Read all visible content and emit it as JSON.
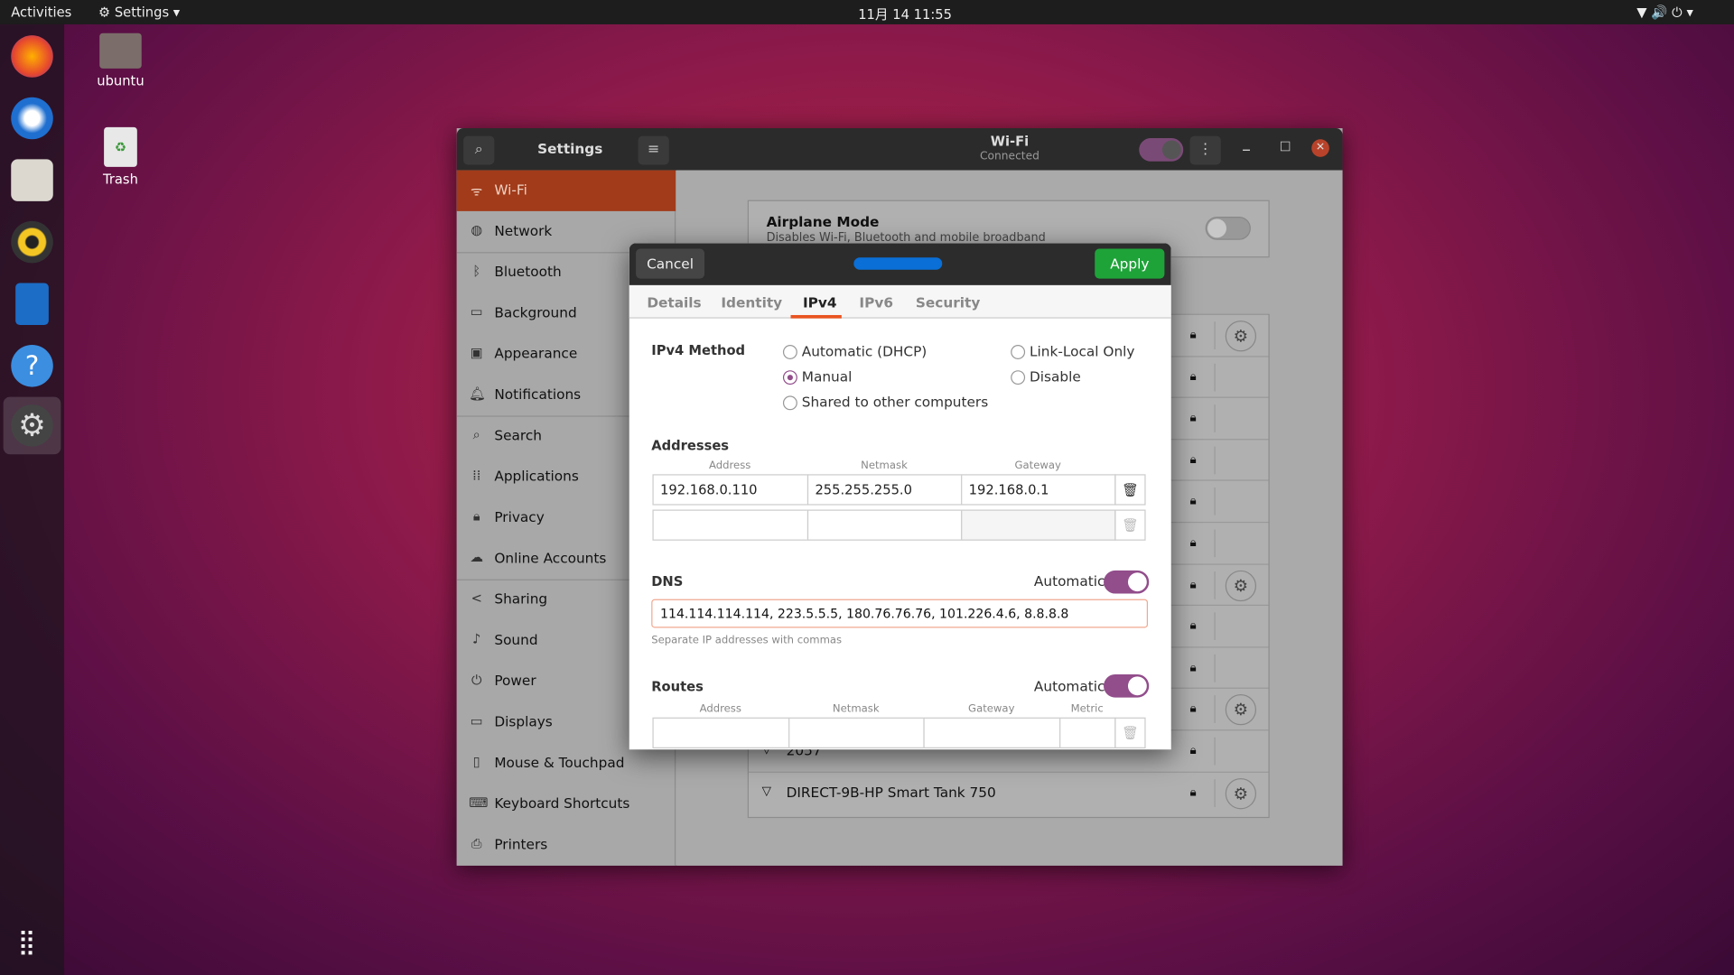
{
  "topbar": {
    "activities": "Activities",
    "app_menu": "Settings",
    "clock": "11月 14  11:55"
  },
  "desktop": {
    "icons": [
      {
        "label": "ubuntu"
      },
      {
        "label": "Trash"
      }
    ]
  },
  "dock": {
    "apps": [
      "Firefox",
      "Thunderbird",
      "Files",
      "Rhythmbox",
      "LibreOffice Writer",
      "Help",
      "Settings"
    ]
  },
  "settings": {
    "title": "Settings",
    "panel_title": "Wi-Fi",
    "panel_subtitle": "Connected",
    "sidebar": [
      {
        "label": "Wi-Fi",
        "icon": "wifi-icon"
      },
      {
        "label": "Network",
        "icon": "network-icon"
      },
      {
        "label": "Bluetooth",
        "icon": "bluetooth-icon"
      },
      {
        "label": "Background",
        "icon": "background-icon"
      },
      {
        "label": "Appearance",
        "icon": "appearance-icon"
      },
      {
        "label": "Notifications",
        "icon": "bell-icon"
      },
      {
        "label": "Search",
        "icon": "search-icon"
      },
      {
        "label": "Applications",
        "icon": "applications-icon"
      },
      {
        "label": "Privacy",
        "icon": "lock-icon"
      },
      {
        "label": "Online Accounts",
        "icon": "cloud-icon"
      },
      {
        "label": "Sharing",
        "icon": "share-icon"
      },
      {
        "label": "Sound",
        "icon": "music-icon"
      },
      {
        "label": "Power",
        "icon": "power-icon"
      },
      {
        "label": "Displays",
        "icon": "display-icon"
      },
      {
        "label": "Mouse & Touchpad",
        "icon": "mouse-icon"
      },
      {
        "label": "Keyboard Shortcuts",
        "icon": "keyboard-icon"
      },
      {
        "label": "Printers",
        "icon": "printer-icon"
      }
    ],
    "airplane": {
      "title": "Airplane Mode",
      "desc": "Disables Wi-Fi, Bluetooth and mobile broadband",
      "on": false
    },
    "networks": [
      {
        "name": "2057"
      },
      {
        "name": "DIRECT-9B-HP Smart Tank 750"
      }
    ]
  },
  "dialog": {
    "cancel": "Cancel",
    "apply": "Apply",
    "tabs": [
      "Details",
      "Identity",
      "IPv4",
      "IPv6",
      "Security"
    ],
    "active_tab": "IPv4",
    "method_label": "IPv4 Method",
    "methods": [
      "Automatic (DHCP)",
      "Link-Local Only",
      "Manual",
      "Disable",
      "Shared to other computers"
    ],
    "selected_method": "Manual",
    "addresses_label": "Addresses",
    "addr_cols": [
      "Address",
      "Netmask",
      "Gateway"
    ],
    "addresses": [
      [
        "192.168.0.110",
        "255.255.255.0",
        "192.168.0.1"
      ],
      [
        "",
        "",
        ""
      ]
    ],
    "dns_label": "DNS",
    "automatic": "Automatic",
    "dns_value": "114.114.114.114, 223.5.5.5, 180.76.76.76, 101.226.4.6, 8.8.8.8",
    "dns_hint": "Separate IP addresses with commas",
    "routes_label": "Routes",
    "route_cols": [
      "Address",
      "Netmask",
      "Gateway",
      "Metric"
    ],
    "dns_auto": true,
    "routes_auto": true,
    "accent": "#924d8b",
    "apply_color": "#1ea339"
  }
}
